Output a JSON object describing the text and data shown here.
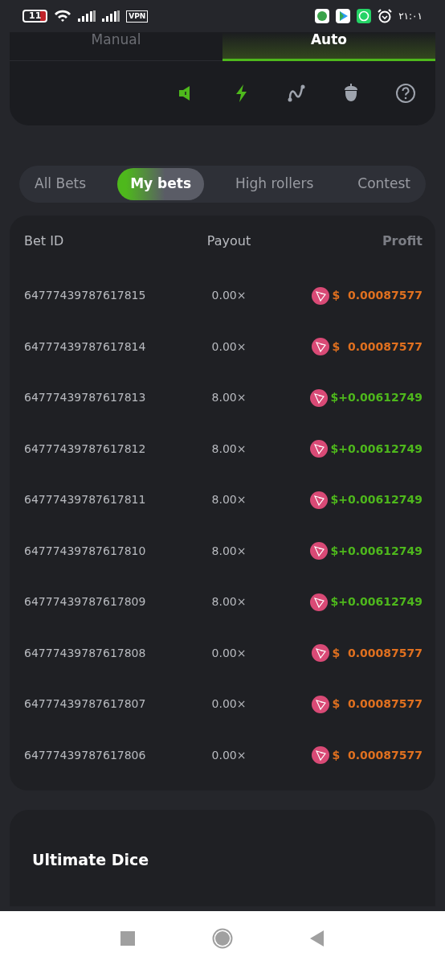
{
  "status_bar": {
    "battery": "11",
    "vpn": "VPN",
    "time": "٢١:٠١"
  },
  "mode_tabs": [
    {
      "label": "Manual",
      "selected": false
    },
    {
      "label": "Auto",
      "selected": true
    }
  ],
  "toolbar": [
    {
      "kind": "sound",
      "active": true
    },
    {
      "kind": "bolt",
      "active": true
    },
    {
      "kind": "curve",
      "active": false
    },
    {
      "kind": "acorn",
      "active": false
    },
    {
      "kind": "help",
      "active": false
    }
  ],
  "bet_tabs": [
    {
      "label": "All Bets",
      "selected": false
    },
    {
      "label": "My bets",
      "selected": true
    },
    {
      "label": "High rollers",
      "selected": false
    },
    {
      "label": "Contest",
      "selected": false
    }
  ],
  "table": {
    "columns": [
      "Bet ID",
      "Payout",
      "Profit"
    ],
    "rows": [
      {
        "bet_id": "64777439787617815",
        "payout": "0.00×",
        "kind": "loss",
        "currency": "$",
        "amount": "0.00087577"
      },
      {
        "bet_id": "64777439787617814",
        "payout": "0.00×",
        "kind": "loss",
        "currency": "$",
        "amount": "0.00087577"
      },
      {
        "bet_id": "64777439787617813",
        "payout": "8.00×",
        "kind": "win",
        "currency": "$",
        "amount": "+0.00612749"
      },
      {
        "bet_id": "64777439787617812",
        "payout": "8.00×",
        "kind": "win",
        "currency": "$",
        "amount": "+0.00612749"
      },
      {
        "bet_id": "64777439787617811",
        "payout": "8.00×",
        "kind": "win",
        "currency": "$",
        "amount": "+0.00612749"
      },
      {
        "bet_id": "64777439787617810",
        "payout": "8.00×",
        "kind": "win",
        "currency": "$",
        "amount": "+0.00612749"
      },
      {
        "bet_id": "64777439787617809",
        "payout": "8.00×",
        "kind": "win",
        "currency": "$",
        "amount": "+0.00612749"
      },
      {
        "bet_id": "64777439787617808",
        "payout": "0.00×",
        "kind": "loss",
        "currency": "$",
        "amount": "0.00087577"
      },
      {
        "bet_id": "64777439787617807",
        "payout": "0.00×",
        "kind": "loss",
        "currency": "$",
        "amount": "0.00087577"
      },
      {
        "bet_id": "64777439787617806",
        "payout": "0.00×",
        "kind": "loss",
        "currency": "$",
        "amount": "0.00087577"
      }
    ]
  },
  "game_card": {
    "title": "Ultimate Dice"
  }
}
